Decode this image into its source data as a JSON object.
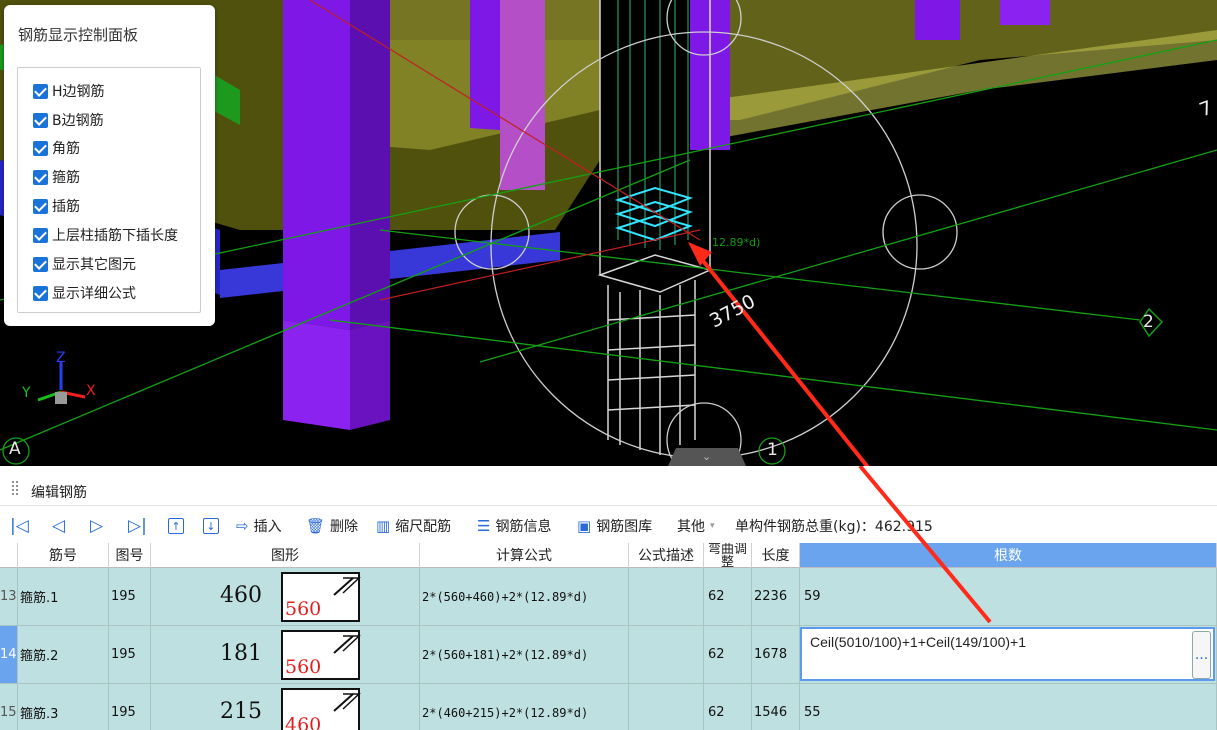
{
  "viewport": {
    "axis_labels": {
      "a": "A",
      "one": "1",
      "two": "2"
    },
    "dimension_text": "3750",
    "dimension_right": "7",
    "formula_overlay": "12.89*d)",
    "gizmo": {
      "x": "X",
      "y": "Y",
      "z": "Z"
    },
    "collapse_icon": "chevron-down-icon"
  },
  "panel": {
    "title": "钢筋显示控制面板",
    "options": [
      {
        "label": "H边钢筋",
        "checked": true
      },
      {
        "label": "B边钢筋",
        "checked": true
      },
      {
        "label": "角筋",
        "checked": true
      },
      {
        "label": "箍筋",
        "checked": true
      },
      {
        "label": "插筋",
        "checked": true
      },
      {
        "label": "上层柱插筋下插长度",
        "checked": true
      },
      {
        "label": "显示其它图元",
        "checked": true
      },
      {
        "label": "显示详细公式",
        "checked": true
      }
    ]
  },
  "editor": {
    "title": "编辑钢筋",
    "toolbar": {
      "insert": "插入",
      "delete": "删除",
      "scale": "缩尺配筋",
      "info": "钢筋信息",
      "library": "钢筋图库",
      "other": "其他",
      "total_weight_label": "单构件钢筋总重(kg)：462.915"
    },
    "columns": [
      "筋号",
      "图号",
      "图形",
      "计算公式",
      "公式描述",
      "弯曲调整",
      "长度",
      "根数"
    ],
    "rows": [
      {
        "num": "13",
        "name": "箍筋.1",
        "fig": "195",
        "shape_top": "460",
        "shape_side": "560",
        "formula": "2*(560+460)+2*(12.89*d)",
        "desc": "",
        "bend": "62",
        "length": "2236",
        "count": "59"
      },
      {
        "num": "14",
        "name": "箍筋.2",
        "fig": "195",
        "shape_top": "181",
        "shape_side": "560",
        "formula": "2*(560+181)+2*(12.89*d)",
        "desc": "",
        "bend": "62",
        "length": "1678",
        "count": "Ceil(5010/100)+1+Ceil(149/100)+1"
      },
      {
        "num": "15",
        "name": "箍筋.3",
        "fig": "195",
        "shape_top": "215",
        "shape_side": "460",
        "formula": "2*(460+215)+2*(12.89*d)",
        "desc": "",
        "bend": "62",
        "length": "1546",
        "count": "55"
      }
    ],
    "edit_button": "..."
  },
  "colors": {
    "accent": "#2a6ad8",
    "row_bg": "#bfe0e1",
    "header_selected": "#6aa4ee",
    "purple": "#8a1ef0",
    "arrow": "#ff2a1a"
  }
}
